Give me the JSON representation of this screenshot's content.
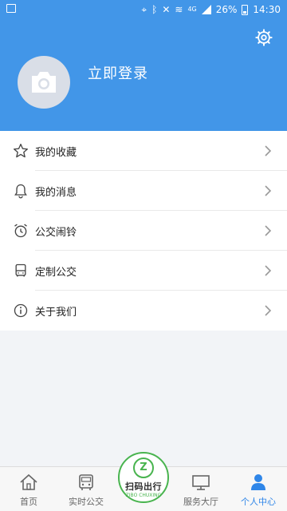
{
  "status": {
    "network": "4G",
    "battery": "26%",
    "time": "14:30"
  },
  "header": {
    "login_label": "立即登录",
    "settings_icon": "gear-icon",
    "avatar_icon": "camera-icon"
  },
  "menu": {
    "items": [
      {
        "label": "我的收藏",
        "icon": "star-icon"
      },
      {
        "label": "我的消息",
        "icon": "bell-icon"
      },
      {
        "label": "公交闹铃",
        "icon": "alarm-clock-icon"
      },
      {
        "label": "定制公交",
        "icon": "bus-icon"
      },
      {
        "label": "关于我们",
        "icon": "info-icon"
      }
    ]
  },
  "tabbar": {
    "tabs": [
      {
        "label": "首页",
        "icon": "home-icon"
      },
      {
        "label": "实时公交",
        "icon": "bus-icon"
      },
      {
        "label": "服务大厅",
        "icon": "monitor-icon"
      },
      {
        "label": "个人中心",
        "icon": "user-icon"
      }
    ],
    "scan": {
      "badge": "Z",
      "label": "扫码出行",
      "sub": "ZIBO CHUXING"
    }
  },
  "colors": {
    "primary": "#4296e8",
    "accent_green": "#49b44f",
    "active_tab": "#2f86e8"
  }
}
